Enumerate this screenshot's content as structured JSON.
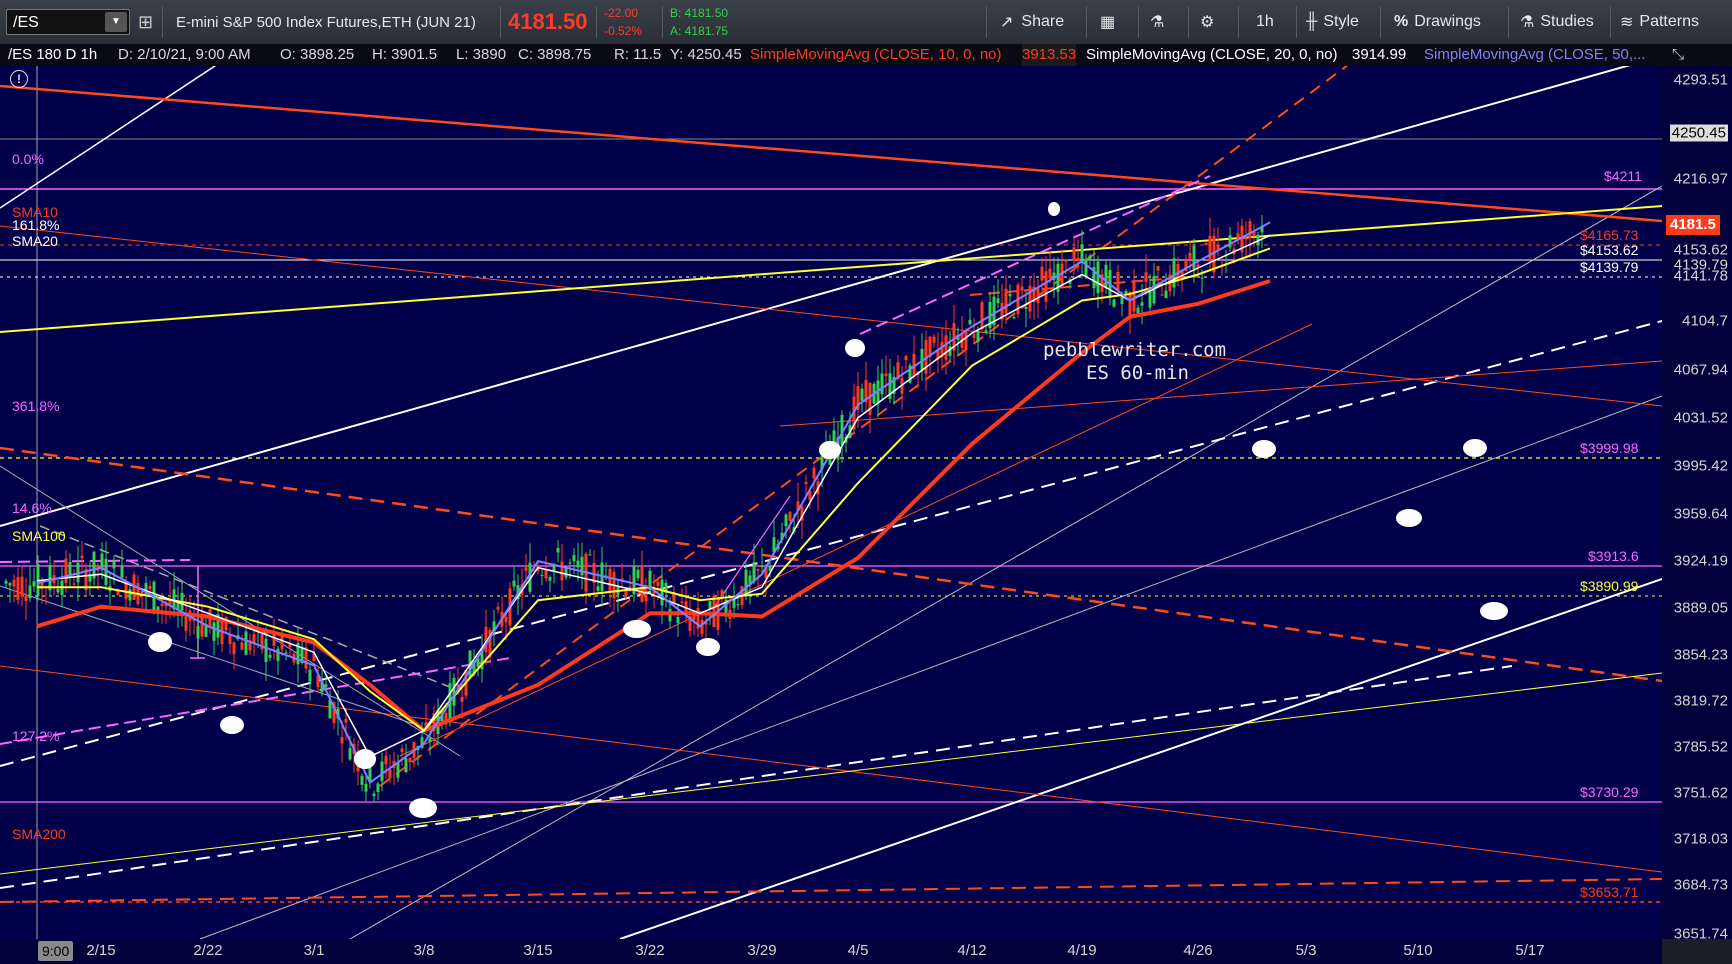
{
  "toolbar": {
    "symbol": "/ES",
    "description": "E-mini S&P 500 Index Futures,ETH (JUN 21)",
    "last_price": "4181.50",
    "change": "-22.00",
    "change_pct": "-0.52%",
    "bid": "B: 4181.50",
    "ask": "A: 4181.75",
    "share_label": "Share",
    "interval_label": "1h",
    "style_label": "Style",
    "drawings_label": "Drawings",
    "studies_label": "Studies",
    "patterns_label": "Patterns"
  },
  "infobar": {
    "title": "/ES 180 D 1h",
    "date": "D: 2/10/21, 9:00 AM",
    "open": "O: 3898.25",
    "high": "H: 3901.5",
    "low": "L: 3890",
    "close": "C: 3898.75",
    "range": "R: 11.5",
    "y": "Y: 4250.45",
    "sma10_label": "SimpleMovingAvg (CLOSE, 10, 0, no)",
    "sma10_value": "3913.53",
    "sma20_label": "SimpleMovingAvg (CLOSE, 20, 0, no)",
    "sma20_value": "3914.99",
    "sma50_label": "SimpleMovingAvg (CLOSE, 50,..."
  },
  "colors": {
    "background": "#00004a",
    "sma10": "#8080ff",
    "sma20": "#ffffff",
    "sma50": "#ffff33",
    "sma100": "#ff3a1a",
    "fib": "#ff66ff",
    "trend_orange": "#ff4a1a",
    "up": "#35d14a",
    "down": "#ff3a1a"
  },
  "price_axis": [
    "4293.51",
    "4250.45",
    "4216.97",
    "4181.5",
    "4153.62",
    "4139.79",
    "4141.78",
    "4104.7",
    "4067.94",
    "4031.52",
    "3995.42",
    "3959.64",
    "3924.19",
    "3889.05",
    "3854.23",
    "3819.72",
    "3785.52",
    "3751.62",
    "3718.03",
    "3684.73",
    "3651.74"
  ],
  "date_axis": [
    "9:00",
    "2/15",
    "2/22",
    "3/1",
    "3/8",
    "3/15",
    "3/22",
    "3/29",
    "4/5",
    "4/12",
    "4/19",
    "4/26",
    "5/3",
    "5/10",
    "5/17"
  ],
  "left_labels": {
    "fib0": "0.0%",
    "sma10": "SMA10",
    "fib161": "161.8%",
    "sma20": "SMA20",
    "fib_overlap": "361.8%",
    "fib146": "14.6%",
    "sma100": "SMA100",
    "fib1272": "127.2%",
    "sma200": "SMA200"
  },
  "right_tags": {
    "t4211": "$4211",
    "t4165": "$4165.73",
    "t4153": "$4153.62",
    "t4139": "$4139.79",
    "t3999": "$3999.98",
    "t3913": "$3913.6",
    "t3890": "$3890.99",
    "t3730": "$3730.29",
    "t3653": "$3653.71"
  },
  "watermark": {
    "line1": "pebblewriter.com",
    "line2": "ES 60-min"
  },
  "chart_data": {
    "type": "line",
    "title": "/ES 180 D 1h",
    "x": [
      "2/10",
      "2/15",
      "2/22",
      "3/1",
      "3/4",
      "3/8",
      "3/15",
      "3/22",
      "3/26",
      "3/29",
      "4/5",
      "4/12",
      "4/19",
      "4/22",
      "4/26",
      "4/29"
    ],
    "series": [
      {
        "name": "SimpleMovingAvg (CLOSE, 10, 0, no)",
        "values": [
          3913,
          3925,
          3880,
          3850,
          3760,
          3790,
          3930,
          3910,
          3880,
          3920,
          4050,
          4110,
          4160,
          4130,
          4160,
          4190
        ]
      },
      {
        "name": "SimpleMovingAvg (CLOSE, 20, 0, no)",
        "values": [
          3915,
          3920,
          3890,
          3860,
          3780,
          3800,
          3925,
          3905,
          3890,
          3910,
          4040,
          4105,
          4150,
          4130,
          4155,
          4180
        ]
      },
      {
        "name": "SimpleMovingAvg (CLOSE, 50,...",
        "values": [
          3910,
          3910,
          3895,
          3870,
          3830,
          3800,
          3900,
          3910,
          3900,
          3905,
          3990,
          4080,
          4130,
          4135,
          4150,
          4170
        ]
      }
    ],
    "ylim": [
      3640,
      4310
    ],
    "grid": false
  }
}
